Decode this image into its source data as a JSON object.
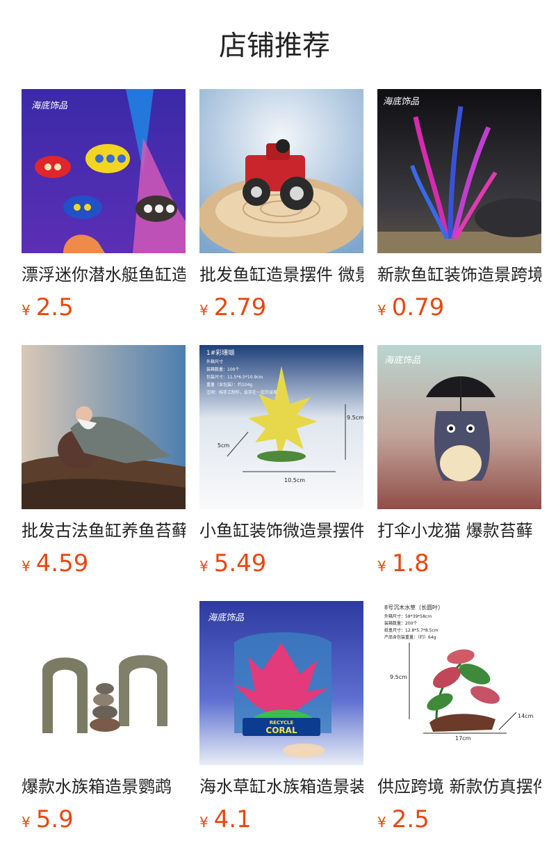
{
  "header": {
    "title": "店铺推荐"
  },
  "currency_symbol": "¥",
  "products": [
    {
      "title": "漂浮迷你潜水艇鱼缸造景摆件",
      "price": "2.5",
      "image": "submarine-toys-image",
      "watermark": "海底饰品"
    },
    {
      "title": "批发鱼缸造景摆件 微景观",
      "price": "2.79",
      "image": "red-tractor-image"
    },
    {
      "title": "新款鱼缸装饰造景跨境",
      "price": "0.79",
      "image": "purple-plant-image",
      "watermark": "海底饰品"
    },
    {
      "title": "批发古法鱼缸养鱼苔藓",
      "price": "4.59",
      "image": "old-man-figurine-image"
    },
    {
      "title": "小鱼缸装饰微造景摆件",
      "price": "5.49",
      "image": "yellow-coral-image",
      "spec": {
        "name": "1#彩珊瑚",
        "size_label": "外箱尺寸",
        "qty": "装箱数量：100个",
        "box": "包装尺寸：11.5*6.5*10.9cm",
        "weight": "重量（含包装）：约104g",
        "note": "注明：纯手工制作，会存在一定的误差",
        "w": "10.5cm",
        "h": "9.5cm",
        "d": "5cm"
      }
    },
    {
      "title": "打伞小龙猫 爆款苔藓",
      "price": "1.8",
      "image": "totoro-umbrella-image",
      "watermark": "海底饰品"
    },
    {
      "title": "爆款水族箱造景鹦鹉",
      "price": "5.9",
      "image": "stone-arches-image"
    },
    {
      "title": "海水草缸水族箱造景装饰",
      "price": "4.1",
      "image": "recycle-coral-image",
      "watermark": "海底饰品",
      "brand_top": "RECYCLE",
      "brand": "CORAL"
    },
    {
      "title": "供应跨境 新款仿真摆件",
      "price": "2.5",
      "image": "driftwood-plant-image",
      "spec": {
        "name": "8号沉木水草（长圆叶）",
        "outer": "外箱尺寸：58*39*58cm",
        "qty": "装箱数量：200个",
        "box": "纸盒尺寸：12.8*5.7*8.5cm",
        "weight": "产品含包装重量：（约）64g",
        "w": "17cm",
        "h": "9.5cm",
        "d": "14cm"
      }
    }
  ]
}
